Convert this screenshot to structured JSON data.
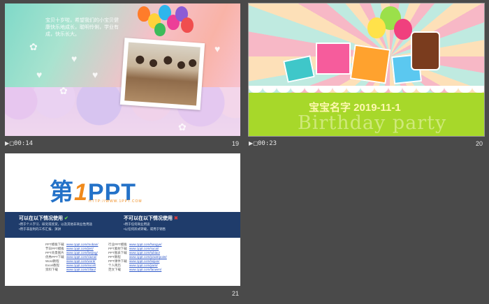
{
  "slides": [
    {
      "id": "19",
      "time": "00:14",
      "number": "19",
      "text": "宝贝十岁啦，希望我们的小宝贝健康快乐地成长，聪明伶俐，学业有成，快乐长大。",
      "colors": {
        "accent": "#7fd9c8"
      }
    },
    {
      "id": "20",
      "time": "00:23",
      "number": "20",
      "title_line": "宝宝名字 2019-11-1",
      "subtitle": "Birthday party",
      "colors": {
        "ground": "#a7d82a"
      }
    },
    {
      "id": "21",
      "time": "",
      "number": "21",
      "logo_main": "第",
      "logo_one": "1",
      "logo_ppt": "PPT",
      "logo_url": "HTTP://WWW.1PPT.COM",
      "left_heading": "可以在以下情况使用",
      "left_lines": [
        "•用于个人学习、研究或欣赏，以及其他非商业性用途",
        "•用于非盈利的工作汇报、演讲"
      ],
      "right_heading": "不可以在以下情况使用",
      "right_lines": [
        "•用于任何商业用途",
        "•以任何形式转载，或用于销售"
      ],
      "links_left_labels": [
        "PPT模板下载",
        "节日PPT模板",
        "PPT背景图片",
        "优秀PPT下载",
        "Word教程",
        "Excel教程",
        "资料下载"
      ],
      "links_left_urls": [
        "www.1ppt.com/moban/",
        "www.1ppt.com/jieri/",
        "www.1ppt.com/beijing/",
        "www.1ppt.com/xiazai/",
        "www.1ppt.com/word/",
        "www.1ppt.com/excel/",
        "www.1ppt.com/ziliao/"
      ],
      "links_right_labels": [
        "行业PPT模板",
        "PPT素材下载",
        "PPT图表下载",
        "PPT教程",
        "PPT课件下载",
        "个人简历",
        "范文下载"
      ],
      "links_right_urls": [
        "www.1ppt.com/hangye/",
        "www.1ppt.com/sucai/",
        "www.1ppt.com/tubiao/",
        "www.1ppt.com/powerpoint/",
        "www.1ppt.com/kejian/",
        "www.1ppt.com/jianli/",
        "www.1ppt.com/fanwen/"
      ]
    }
  ],
  "icons": {
    "play": "play-icon",
    "check": "check-icon",
    "cross": "cross-icon"
  }
}
